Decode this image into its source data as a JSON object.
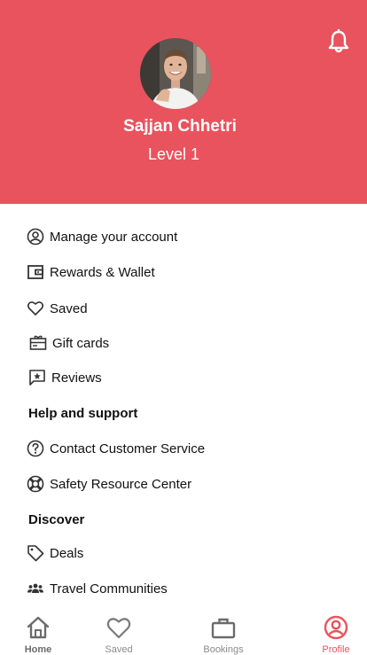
{
  "profile": {
    "name": "Sajjan Chhetri",
    "level": "Level 1"
  },
  "menu": [
    {
      "label": "Manage your account",
      "icon": "user-circle-icon"
    },
    {
      "label": "Rewards & Wallet",
      "icon": "wallet-icon"
    },
    {
      "label": "Saved",
      "icon": "heart-icon"
    },
    {
      "label": "Gift cards",
      "icon": "gift-card-icon"
    },
    {
      "label": "Reviews",
      "icon": "review-icon"
    }
  ],
  "help": {
    "title": "Help and support",
    "items": [
      {
        "label": "Contact Customer Service",
        "icon": "question-circle-icon"
      },
      {
        "label": "Safety Resource Center",
        "icon": "lifebuoy-icon"
      }
    ]
  },
  "discover": {
    "title": "Discover",
    "items": [
      {
        "label": "Deals",
        "icon": "tag-icon"
      },
      {
        "label": "Travel Communities",
        "icon": "community-icon"
      }
    ]
  },
  "nav": [
    {
      "label": "Home",
      "icon": "home-icon"
    },
    {
      "label": "Saved",
      "icon": "heart-icon"
    },
    {
      "label": "Bookings",
      "icon": "briefcase-icon"
    },
    {
      "label": "Profile",
      "icon": "profile-icon",
      "active": true
    }
  ],
  "colors": {
    "accent": "#e8535d",
    "text": "#111111",
    "nav_inactive": "#8a8a8a"
  }
}
